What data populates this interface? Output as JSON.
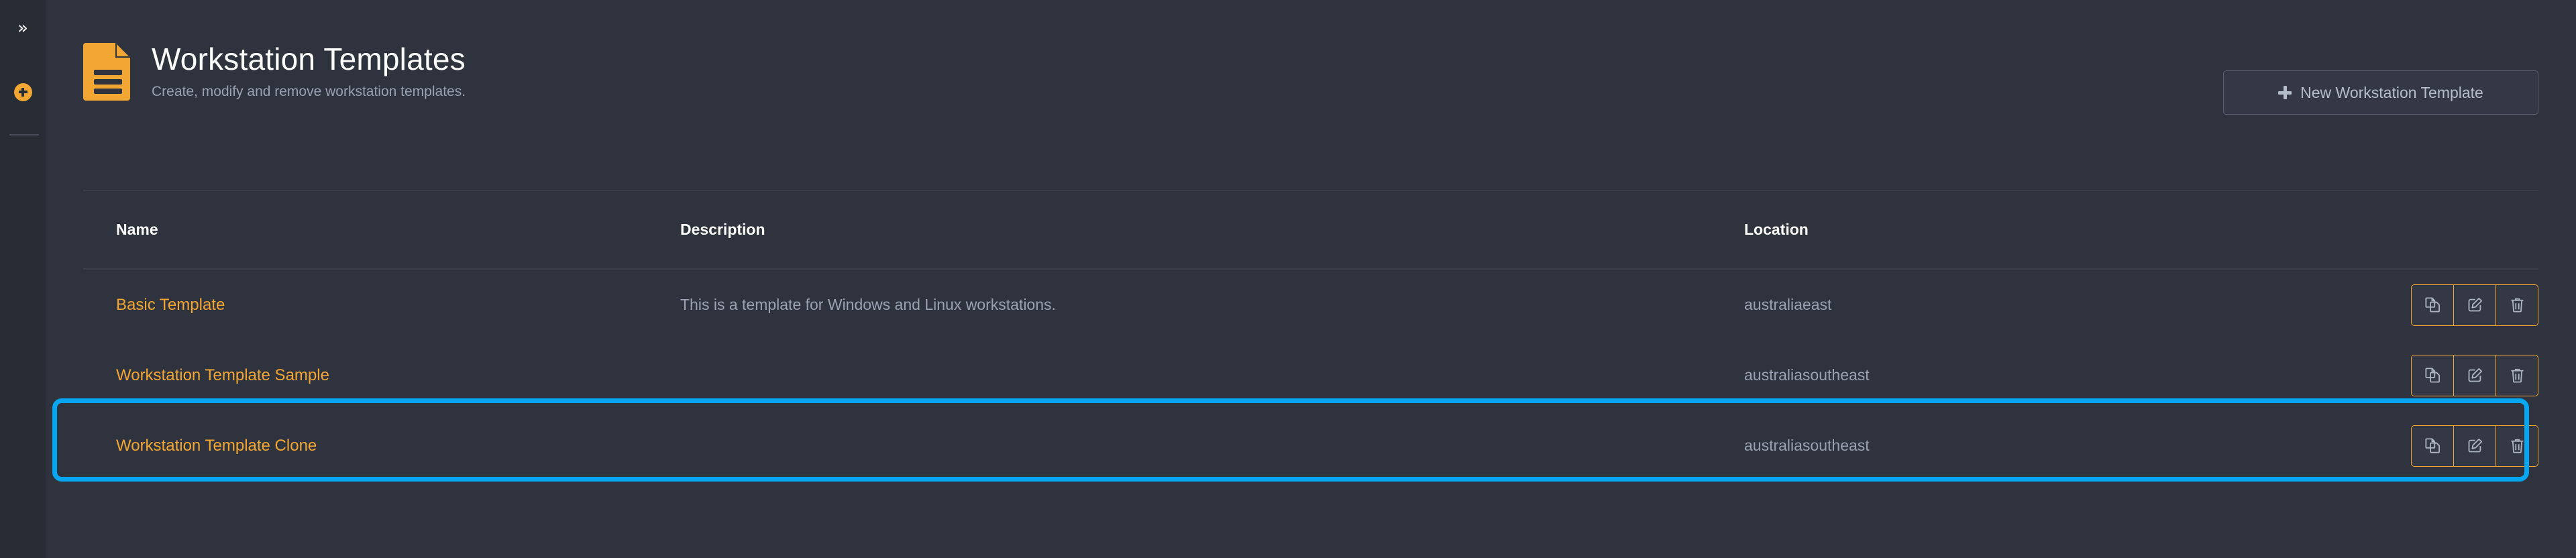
{
  "rail": {
    "expand_icon": "double-chevron-right-icon",
    "expand_glyph": "»",
    "add_icon": "plus-circle-icon"
  },
  "header": {
    "icon": "document-template-icon",
    "title": "Workstation Templates",
    "subtitle": "Create, modify and remove workstation templates.",
    "new_button": {
      "icon": "plus-icon",
      "label": "New Workstation Template"
    }
  },
  "table": {
    "columns": [
      "Name",
      "Description",
      "Location"
    ],
    "action_icons": [
      "copy-icon",
      "edit-icon",
      "delete-icon"
    ],
    "rows": [
      {
        "name": "Basic Template",
        "description": "This is a template for Windows and Linux workstations.",
        "location": "australiaeast",
        "selected": false
      },
      {
        "name": "Workstation Template Sample",
        "description": "",
        "location": "australiasoutheast",
        "selected": false
      },
      {
        "name": "Workstation Template Clone",
        "description": "",
        "location": "australiasoutheast",
        "selected": true
      }
    ]
  },
  "colors": {
    "accent_orange": "#f2a633",
    "selection_blue": "#06a7f0",
    "background": "#2f333d",
    "rail_background": "#282c35",
    "row_highlight": "#3a3f4b",
    "muted_text": "#9aa2b1"
  }
}
